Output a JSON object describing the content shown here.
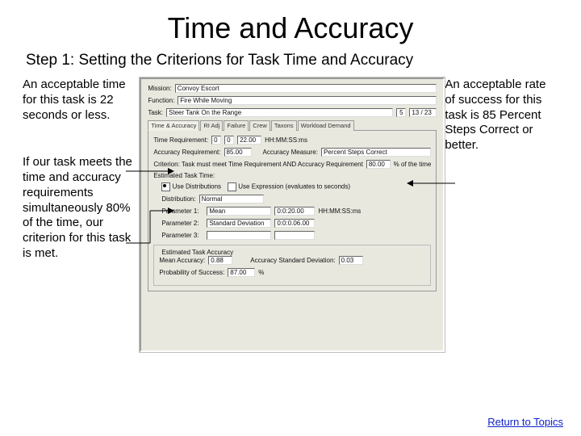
{
  "title": "Time and Accuracy",
  "subtitle": "Step 1:  Setting the Criterions for Task Time and Accuracy",
  "left_note_1": "An acceptable time for this task is 22 seconds or less.",
  "left_note_2": "If our task meets the time and accuracy requirements simultaneously 80% of the time, our criterion for this task is met.",
  "right_note_1": "An acceptable rate of success for this task is 85 Percent Steps Correct or better.",
  "panel": {
    "mission_label": "Mission:",
    "mission_value": "Convoy Escort",
    "function_label": "Function:",
    "function_value": "Fire While Moving",
    "task_label": "Task:",
    "task_value": "Steer Tank On the Range",
    "task_no": "5",
    "task_of": "13 / 23",
    "tabs": [
      "Time & Accuracy",
      "RI Adj",
      "Failure",
      "Crew",
      "Taxons",
      "Workload Demand"
    ],
    "time_req_label": "Time Requirement:",
    "time_hh": "0",
    "time_mm": "0",
    "time_ss": "22.00",
    "time_hhmmssms": "HH:MM:SS:ms",
    "acc_req_label": "Accuracy Requirement:",
    "acc_req_value": "85.00",
    "acc_measure_label": "Accuracy Measure:",
    "acc_measure_value": "Percent Steps Correct",
    "criterion_label": "Criterion: Task must meet Time Requirement AND Accuracy Requirement",
    "criterion_value": "80.00",
    "criterion_pct": "% of the time",
    "est_task_time": "Estimated Task Time:",
    "use_dist": "Use Distributions",
    "use_expr": "Use Expression (evaluates to seconds)",
    "dist_label": "Distribution:",
    "dist_value": "Normal",
    "param1_label": "Parameter 1:",
    "param1_name": "Mean",
    "param1_value": "0:0:20.00",
    "param1_unit": "HH:MM:SS:ms",
    "param2_label": "Parameter 2:",
    "param2_name": "Standard Deviation",
    "param2_value": "0:0:0.06.00",
    "param3_label": "Parameter 3:",
    "est_acc_title": "Estimated Task Accuracy",
    "mean_acc_label": "Mean Accuracy:",
    "mean_acc_value": "0.88",
    "acc_sd_label": "Accuracy Standard Deviation:",
    "acc_sd_value": "0.03",
    "prob_label": "Probability of Success:",
    "prob_value": "87.00",
    "prob_pct": "%"
  },
  "footer_link": "Return to Topics"
}
